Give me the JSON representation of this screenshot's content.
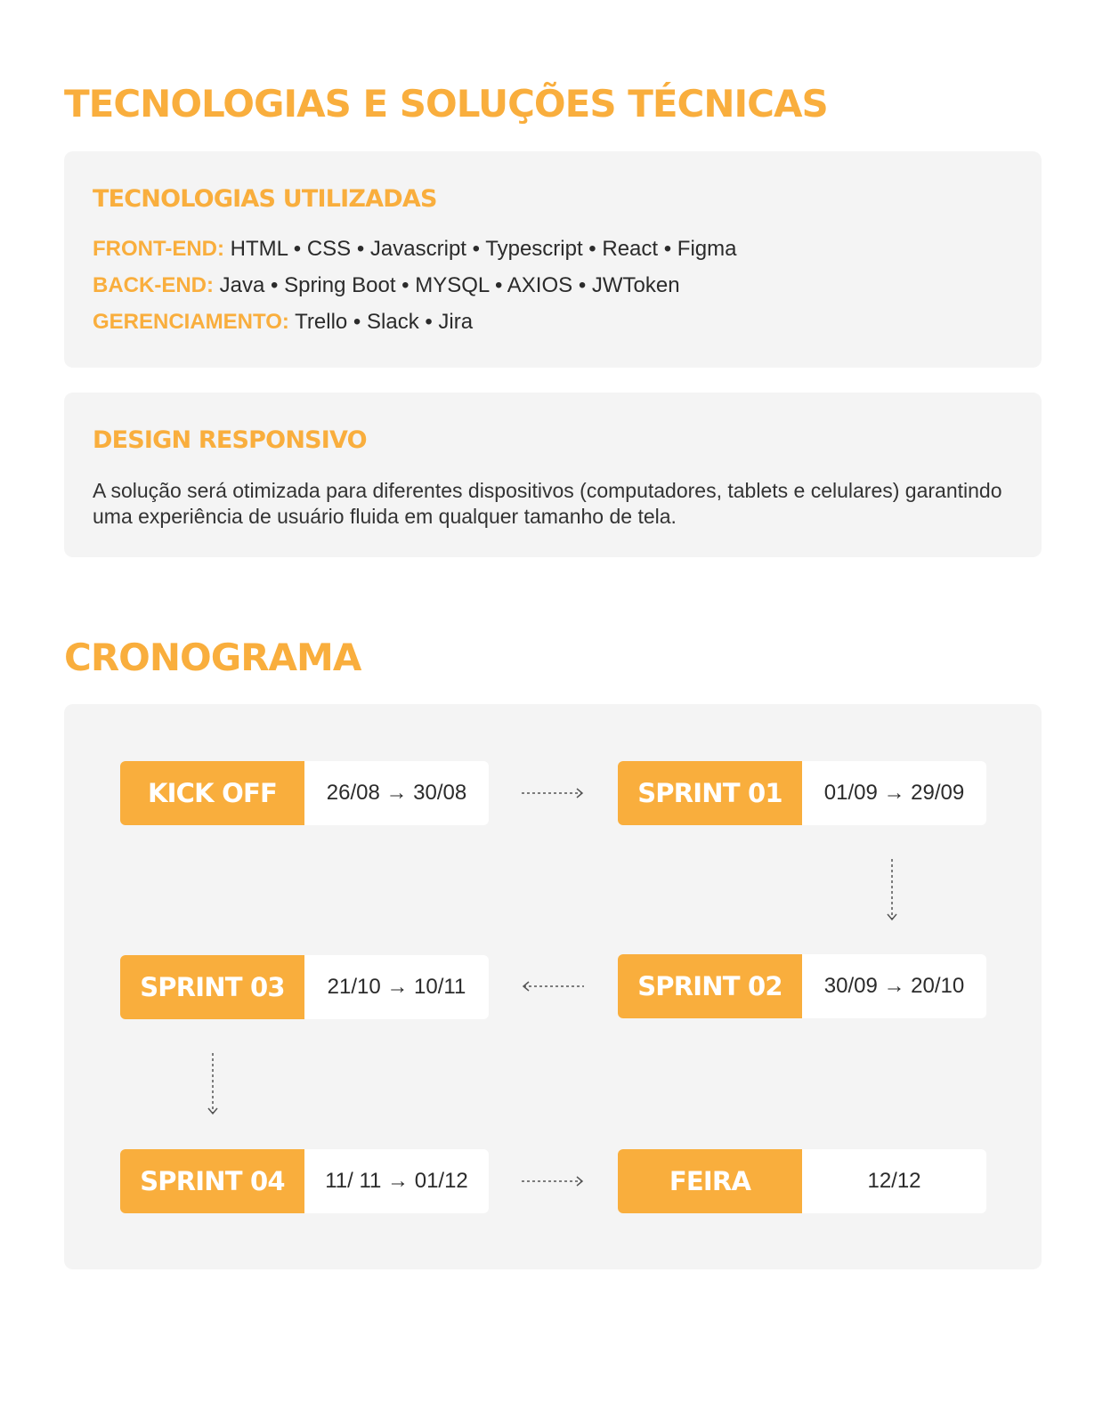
{
  "tech_section": {
    "title": "TECNOLOGIAS E SOLUÇÕES TÉCNICAS",
    "technologies": {
      "title": "TECNOLOGIAS UTILIZADAS",
      "rows": [
        {
          "label": "FRONT-END:",
          "value": " HTML • CSS • Javascript • Typescript • React • Figma"
        },
        {
          "label": "BACK-END:",
          "value": " Java • Spring Boot • MYSQL • AXIOS • JWToken"
        },
        {
          "label": "GERENCIAMENTO:",
          "value": " Trello • Slack • Jira"
        }
      ]
    },
    "responsive": {
      "title": "DESIGN RESPONSIVO",
      "text": "A solução será otimizada para diferentes dispositivos (computadores, tablets e celulares) garantindo uma experiência de usuário fluida em qualquer tamanho de tela."
    }
  },
  "schedule": {
    "title": "CRONOGRAMA",
    "steps": [
      {
        "name": "KICK OFF",
        "dates": "26/08 → 30/08"
      },
      {
        "name": "SPRINT 01",
        "dates": "01/09 → 29/09"
      },
      {
        "name": "SPRINT 02",
        "dates": "30/09 → 20/10"
      },
      {
        "name": "SPRINT 03",
        "dates": "21/10 → 10/11"
      },
      {
        "name": "SPRINT 04",
        "dates": "11/ 11 → 01/12"
      },
      {
        "name": "FEIRA",
        "dates": "12/12"
      }
    ]
  },
  "colors": {
    "accent": "#F9AE3D",
    "card_background": "#F4F4F4",
    "text": "#2B2B2B"
  }
}
